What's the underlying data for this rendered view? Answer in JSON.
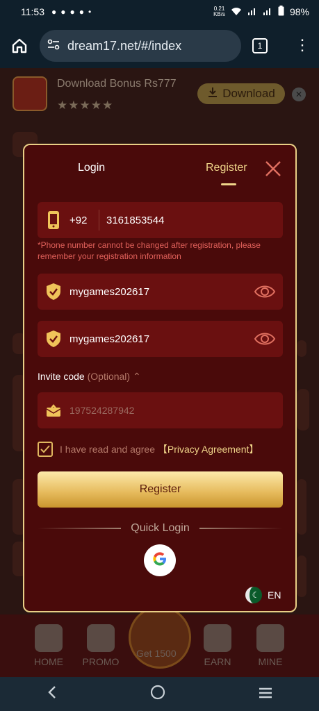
{
  "status": {
    "time": "11:53",
    "speed_value": "0.21",
    "speed_unit": "KB/s",
    "battery": "98%"
  },
  "browser": {
    "url": "dream17.net/#/index",
    "tab_count": "1"
  },
  "banner": {
    "title": "Download Bonus Rs777",
    "stars": "★★★★★",
    "download_label": "Download"
  },
  "modal": {
    "tab_login": "Login",
    "tab_register": "Register",
    "country_code": "+92",
    "phone_number": "3161853544",
    "phone_note": "*Phone number cannot be changed after registration, please remember your registration information",
    "password": "mygames202617",
    "confirm_password": "mygames202617",
    "invite_label": "Invite code",
    "invite_optional": "(Optional)",
    "invite_placeholder": "197524287942",
    "agree_text": "I have read and agree",
    "privacy_link": "【Privacy Agreement】",
    "register_button": "Register",
    "quick_login": "Quick Login",
    "language": "EN"
  },
  "bottom_nav": {
    "home": "HOME",
    "promo": "PROMO",
    "center": "Get 1500",
    "earn": "EARN",
    "mine": "MINE"
  },
  "colors": {
    "modal_bg": "#4a0a0a",
    "gold": "#f0d58a",
    "error": "#e0605a"
  }
}
